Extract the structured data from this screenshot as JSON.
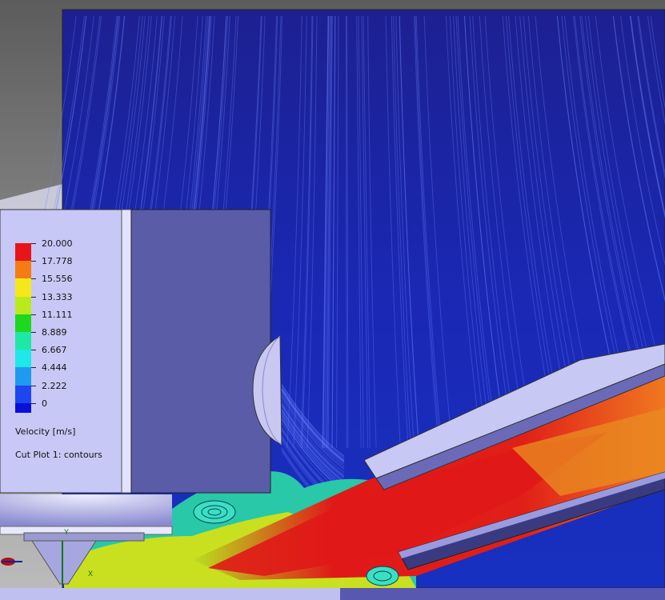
{
  "legend": {
    "title": "Velocity [m/s]",
    "plot_name": "Cut Plot 1: contours",
    "labels": [
      "20.000",
      "17.778",
      "15.556",
      "13.333",
      "11.111",
      "8.889",
      "6.667",
      "4.444",
      "2.222",
      "0"
    ],
    "colors": [
      "#e8141a",
      "#f57c14",
      "#f5e81a",
      "#b8ea1e",
      "#1ed81e",
      "#1ee8a6",
      "#1ee8e8",
      "#1e9af0",
      "#1e46f0",
      "#0a10d8"
    ]
  },
  "scene_colors": {
    "background_top": "#6e6e6e",
    "background_bottom": "#b4b4b4",
    "flow_field": "#1a24b8",
    "panel_light": "#c8c8f6",
    "panel_dark": "#5a5ca8",
    "jet_core": "#e01818"
  },
  "axis_triad": {
    "y_label": "Y",
    "x_label": "X"
  }
}
